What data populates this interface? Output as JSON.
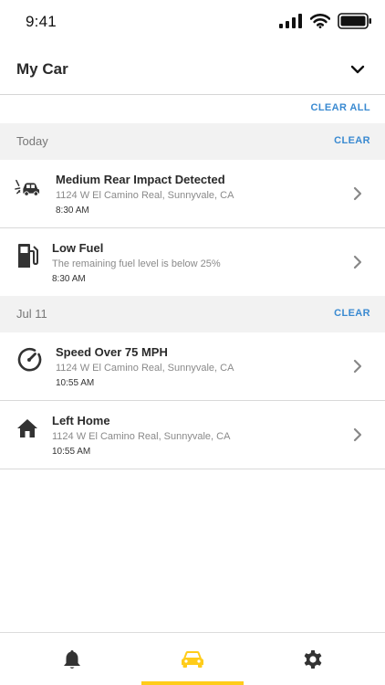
{
  "status_bar": {
    "time": "9:41"
  },
  "header": {
    "title": "My Car"
  },
  "clear_all_label": "CLEAR ALL",
  "sections": [
    {
      "label": "Today",
      "clear_label": "CLEAR",
      "items": [
        {
          "icon": "rear-impact-icon",
          "title": "Medium Rear Impact Detected",
          "subtitle": "1124 W El Camino Real, Sunnyvale, CA",
          "time": "8:30 AM"
        },
        {
          "icon": "fuel-pump-icon",
          "title": "Low Fuel",
          "subtitle": "The remaining fuel level is below 25%",
          "time": "8:30 AM"
        }
      ]
    },
    {
      "label": "Jul 11",
      "clear_label": "CLEAR",
      "items": [
        {
          "icon": "speedometer-icon",
          "title": "Speed Over 75 MPH",
          "subtitle": "1124 W El Camino Real, Sunnyvale, CA",
          "time": "10:55 AM"
        },
        {
          "icon": "home-icon",
          "title": "Left Home",
          "subtitle": "1124 W El Camino Real, Sunnyvale, CA",
          "time": "10:55 AM"
        }
      ]
    }
  ],
  "tabbar": {
    "tabs": [
      {
        "icon": "bell-icon",
        "active": false
      },
      {
        "icon": "car-icon",
        "active": true
      },
      {
        "icon": "gear-icon",
        "active": false
      }
    ],
    "active_color": "#ffcc1a"
  },
  "colors": {
    "accent": "#3a8ad1",
    "section_bg": "#f2f2f2",
    "active_tab": "#ffcc1a"
  }
}
